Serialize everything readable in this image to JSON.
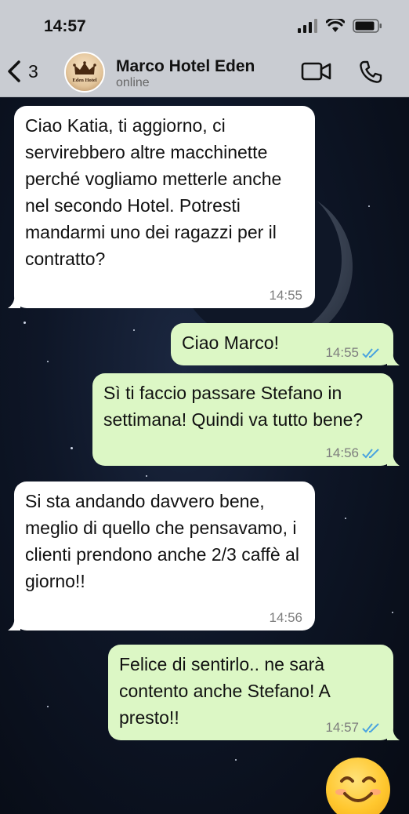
{
  "status_bar": {
    "time": "14:57"
  },
  "header": {
    "back_count": "3",
    "contact_name": "Marco Hotel Eden",
    "contact_status": "online",
    "avatar_text": "Eden Hotel"
  },
  "messages": [
    {
      "direction": "incoming",
      "text": "Ciao Katia, ti aggiorno, ci servirebbero altre macchinette perché vogliamo metterle anche nel secondo Hotel. Potresti mandarmi uno dei ragazzi per il contratto?",
      "time": "14:55"
    },
    {
      "direction": "outgoing",
      "text": "Ciao Marco!",
      "time": "14:55",
      "read": true
    },
    {
      "direction": "outgoing",
      "text": "Sì ti faccio passare Stefano in settimana! Quindi va tutto bene?",
      "time": "14:56",
      "read": true
    },
    {
      "direction": "incoming",
      "text": "Si sta andando davvero bene, meglio di quello che pensavamo, i clienti prendono anche 2/3 caffè al giorno!!",
      "time": "14:56"
    },
    {
      "direction": "outgoing",
      "text": "Felice di sentirlo.. ne sarà contento anche Stefano! A presto!!",
      "time": "14:57",
      "read": true
    }
  ],
  "sticker": {
    "name": "smiling-face-emoji",
    "glyph": "😊"
  },
  "colors": {
    "incoming_bubble": "#ffffff",
    "outgoing_bubble": "#dcf7c5",
    "read_ticks": "#4aa3df",
    "header_bg": "#c9ccd2"
  }
}
